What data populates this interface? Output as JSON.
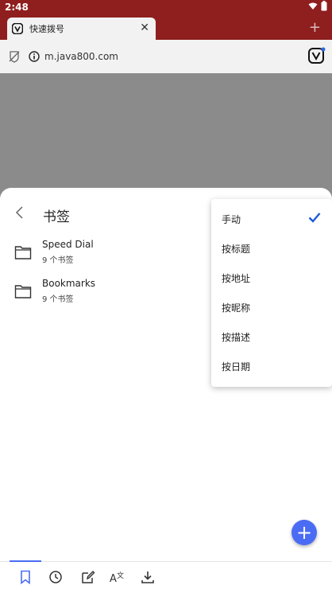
{
  "status_bar": {
    "time": "2:48",
    "icons": [
      "wifi-icon",
      "battery-icon"
    ]
  },
  "tab": {
    "title": "快速拨号",
    "close_glyph": "✕"
  },
  "new_tab_glyph": "+",
  "address_bar": {
    "url": "m.java800.com"
  },
  "bookmarks_panel": {
    "title": "书签",
    "folders": [
      {
        "name": "Speed Dial",
        "count": "9 个书签"
      },
      {
        "name": "Bookmarks",
        "count": "9 个书签"
      }
    ]
  },
  "sort_menu": {
    "items": [
      {
        "label": "手动",
        "selected": true
      },
      {
        "label": "按标题",
        "selected": false
      },
      {
        "label": "按地址",
        "selected": false
      },
      {
        "label": "按昵称",
        "selected": false
      },
      {
        "label": "按描述",
        "selected": false
      },
      {
        "label": "按日期",
        "selected": false
      }
    ]
  },
  "fab": {
    "glyph": "+"
  },
  "bottom_nav": [
    "bookmark-icon",
    "history-icon",
    "notes-icon",
    "translate-icon",
    "download-icon"
  ],
  "colors": {
    "chrome": "#8f1e1e",
    "accent": "#4a6cf5",
    "check": "#1e5bd6"
  }
}
